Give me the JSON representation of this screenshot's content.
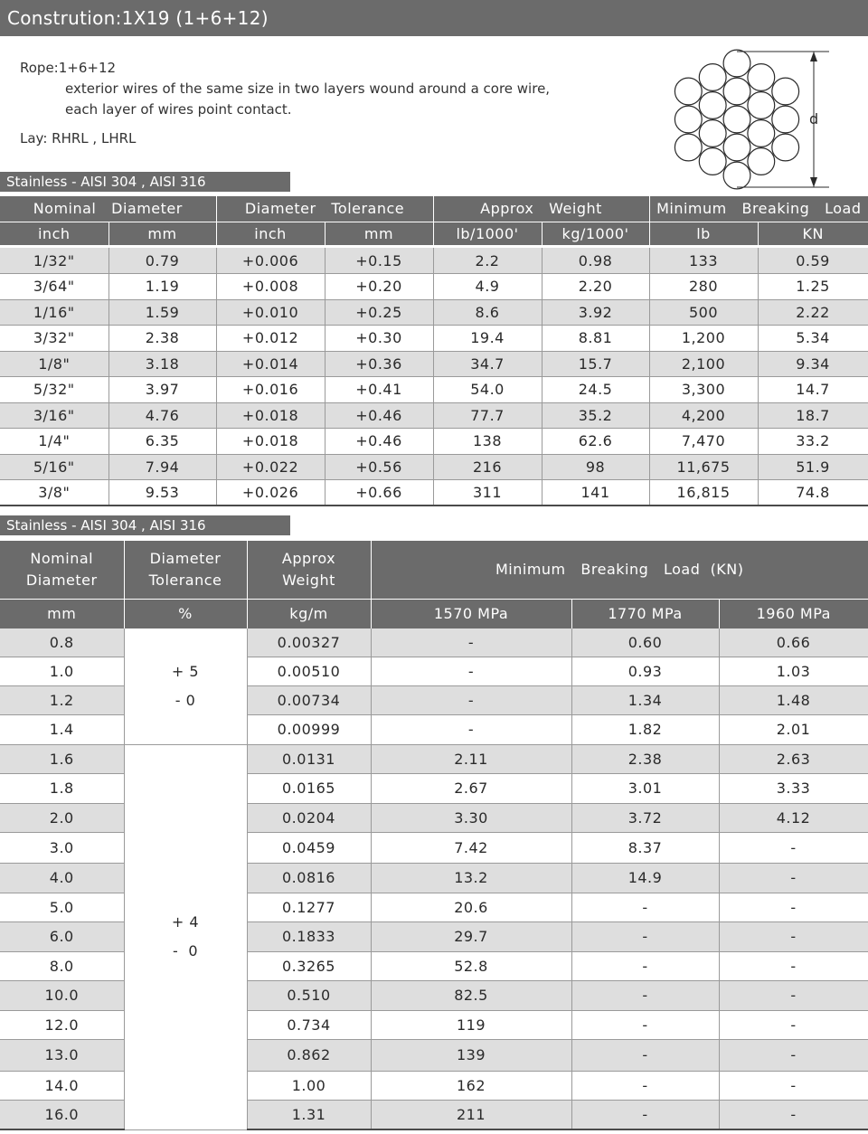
{
  "title": "Constrution:1X19 (1+6+12)",
  "description": {
    "rope_label": "Rope:",
    "rope_value": "1+6+12",
    "line1": "exterior wires of the same size in two layers wound around a core wire,",
    "line2": "each layer of wires point contact.",
    "lay_label": "Lay:",
    "lay_value": "RHRL , LHRL"
  },
  "diagram": {
    "dimension_label": "d"
  },
  "section1": {
    "label": "Stainless - AISI 304 , AISI 316"
  },
  "table1": {
    "group_headers": [
      "Nominal   Diameter",
      "Diameter   Tolerance",
      "Approx   Weight",
      "Minimum   Breaking   Load"
    ],
    "sub_headers": [
      "inch",
      "mm",
      "inch",
      "mm",
      "lb/1000'",
      "kg/1000'",
      "lb",
      "KN"
    ],
    "rows": [
      [
        "1/32\"",
        "0.79",
        "+0.006",
        "+0.15",
        "2.2",
        "0.98",
        "133",
        "0.59"
      ],
      [
        "3/64\"",
        "1.19",
        "+0.008",
        "+0.20",
        "4.9",
        "2.20",
        "280",
        "1.25"
      ],
      [
        "1/16\"",
        "1.59",
        "+0.010",
        "+0.25",
        "8.6",
        "3.92",
        "500",
        "2.22"
      ],
      [
        "3/32\"",
        "2.38",
        "+0.012",
        "+0.30",
        "19.4",
        "8.81",
        "1,200",
        "5.34"
      ],
      [
        "1/8\"",
        "3.18",
        "+0.014",
        "+0.36",
        "34.7",
        "15.7",
        "2,100",
        "9.34"
      ],
      [
        "5/32\"",
        "3.97",
        "+0.016",
        "+0.41",
        "54.0",
        "24.5",
        "3,300",
        "14.7"
      ],
      [
        "3/16\"",
        "4.76",
        "+0.018",
        "+0.46",
        "77.7",
        "35.2",
        "4,200",
        "18.7"
      ],
      [
        "1/4\"",
        "6.35",
        "+0.018",
        "+0.46",
        "138",
        "62.6",
        "7,470",
        "33.2"
      ],
      [
        "5/16\"",
        "7.94",
        "+0.022",
        "+0.56",
        "216",
        "98",
        "11,675",
        "51.9"
      ],
      [
        "3/8\"",
        "9.53",
        "+0.026",
        "+0.66",
        "311",
        "141",
        "16,815",
        "74.8"
      ]
    ]
  },
  "section2": {
    "label": "Stainless - AISI 304 , AISI 316"
  },
  "table2": {
    "headers": {
      "nominal_diameter": "Nominal\nDiameter",
      "diameter_tolerance": "Diameter\nTolerance",
      "approx_weight": "Approx\nWeight",
      "min_breaking_load": "Minimum   Breaking   Load  (KN)"
    },
    "sub_headers": [
      "mm",
      "%",
      "kg/m",
      "1570  MPa",
      "1770  MPa",
      "1960  MPa"
    ],
    "tolerance_group1": "+ 5\n- 0",
    "tolerance_group2": "+ 4\n-  0",
    "rows": [
      [
        "0.8",
        "0.00327",
        "-",
        "0.60",
        "0.66"
      ],
      [
        "1.0",
        "0.00510",
        "-",
        "0.93",
        "1.03"
      ],
      [
        "1.2",
        "0.00734",
        "-",
        "1.34",
        "1.48"
      ],
      [
        "1.4",
        "0.00999",
        "-",
        "1.82",
        "2.01"
      ],
      [
        "1.6",
        "0.0131",
        "2.11",
        "2.38",
        "2.63"
      ],
      [
        "1.8",
        "0.0165",
        "2.67",
        "3.01",
        "3.33"
      ],
      [
        "2.0",
        "0.0204",
        "3.30",
        "3.72",
        "4.12"
      ],
      [
        "3.0",
        "0.0459",
        "7.42",
        "8.37",
        "-"
      ],
      [
        "4.0",
        "0.0816",
        "13.2",
        "14.9",
        "-"
      ],
      [
        "5.0",
        "0.1277",
        "20.6",
        "-",
        "-"
      ],
      [
        "6.0",
        "0.1833",
        "29.7",
        "-",
        "-"
      ],
      [
        "8.0",
        "0.3265",
        "52.8",
        "-",
        "-"
      ],
      [
        "10.0",
        "0.510",
        "82.5",
        "-",
        "-"
      ],
      [
        "12.0",
        "0.734",
        "119",
        "-",
        "-"
      ],
      [
        "13.0",
        "0.862",
        "139",
        "-",
        "-"
      ],
      [
        "14.0",
        "1.00",
        "162",
        "-",
        "-"
      ],
      [
        "16.0",
        "1.31",
        "211",
        "-",
        "-"
      ]
    ]
  }
}
